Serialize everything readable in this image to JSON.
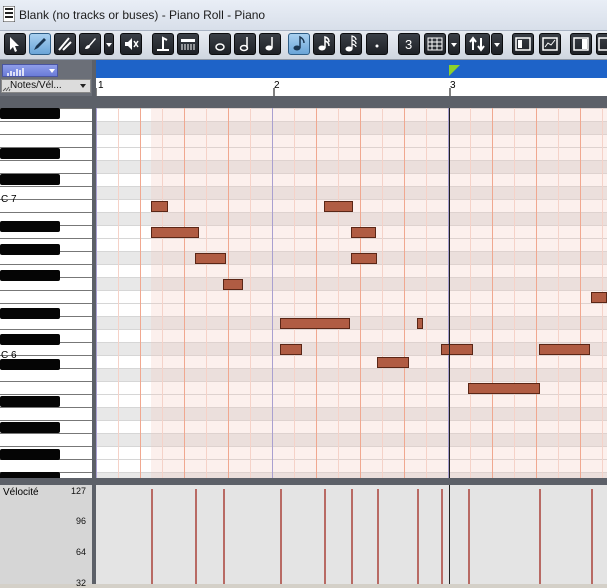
{
  "window": {
    "title": "Blank (no tracks or buses) - Piano Roll - Piano"
  },
  "toolbar": {
    "buttons": [
      {
        "name": "select-tool-button",
        "icon": "select-arrow-icon"
      },
      {
        "name": "draw-tool-button",
        "icon": "pencil-icon",
        "active": true
      },
      {
        "name": "edit-tool-button",
        "icon": "edit-tool-icon"
      },
      {
        "name": "brush-tool-button",
        "icon": "brush-icon"
      },
      {
        "name": "mute-tool-button",
        "icon": "mute-icon"
      },
      {
        "name": "step-record-button",
        "icon": "step-record-icon"
      },
      {
        "name": "drum-map-button",
        "icon": "drum-map-icon"
      },
      {
        "name": "whole-note-button",
        "icon": "whole-note-icon"
      },
      {
        "name": "half-note-button",
        "icon": "half-note-icon"
      },
      {
        "name": "quarter-note-button",
        "icon": "quarter-note-icon"
      },
      {
        "name": "eighth-note-button",
        "icon": "eighth-note-icon",
        "active": true
      },
      {
        "name": "sixteenth-note-button",
        "icon": "sixteenth-note-icon"
      },
      {
        "name": "thirty-second-note-button",
        "icon": "thirty-second-note-icon"
      },
      {
        "name": "dotted-button",
        "icon": "dot-icon"
      },
      {
        "name": "triplet-button",
        "icon": "triplet-icon",
        "text": "3"
      },
      {
        "name": "snap-grid-button",
        "icon": "grid-icon"
      },
      {
        "name": "snap-dropdown-button",
        "icon": "chevron-down-icon"
      },
      {
        "name": "transpose-button",
        "icon": "up-down-arrows-icon"
      },
      {
        "name": "transpose-dropdown-button",
        "icon": "chevron-down-icon"
      },
      {
        "name": "view-piano-button",
        "icon": "piano-view-icon"
      },
      {
        "name": "view-controller-button",
        "icon": "controller-view-icon"
      },
      {
        "name": "layout-button",
        "icon": "layout-icon"
      }
    ]
  },
  "controller": {
    "label": "Notes/Vél...",
    "name": "Vélocité",
    "ticks": [
      "127",
      "96",
      "64",
      "32"
    ]
  },
  "ruler": {
    "bars": [
      "1",
      "2",
      "3"
    ]
  },
  "keyboard": {
    "octave_labels": [
      "C 7",
      "C 6"
    ]
  },
  "colors": {
    "note_fill": "#b05c43",
    "velocity_line": "#b86a64",
    "ruler_blue": "#1e63c8",
    "playhead_marker": "#8cd02a"
  }
}
